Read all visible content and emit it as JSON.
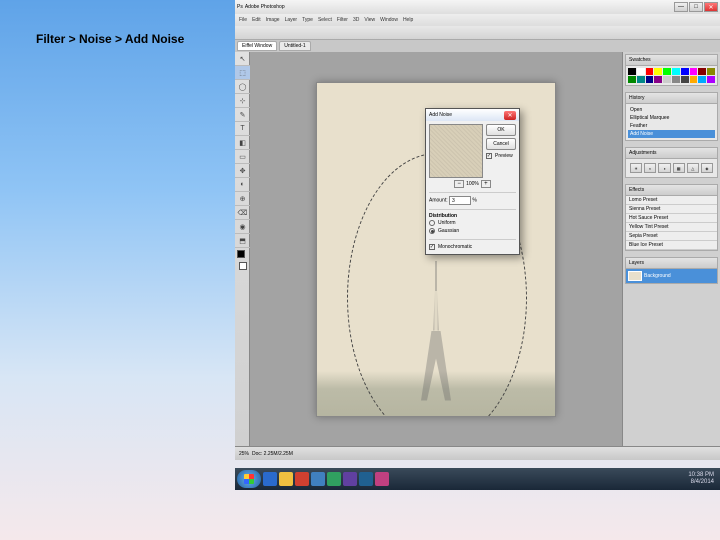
{
  "caption": "Filter > Noise > Add Noise",
  "app": {
    "title": "Adobe Photoshop",
    "menu": [
      "File",
      "Edit",
      "Image",
      "Layer",
      "Type",
      "Select",
      "Filter",
      "3D",
      "View",
      "Window",
      "Help"
    ],
    "win": {
      "min": "—",
      "max": "□",
      "close": "✕"
    }
  },
  "tabs": [
    "Eiffel Window",
    "Untitled-1"
  ],
  "status": {
    "zoom": "25%",
    "doc": "Doc: 2.25M/2.25M"
  },
  "toolbox": [
    "↖",
    "⬚",
    "◯",
    "⊹",
    "✎",
    "T",
    "◧",
    "▭",
    "✥",
    "◐",
    "⊕",
    "⌫",
    "◉",
    "⬒"
  ],
  "panels": {
    "swatches": "Swatches",
    "colors": [
      "#000",
      "#fff",
      "#f00",
      "#ff0",
      "#0f0",
      "#0ff",
      "#00f",
      "#f0f",
      "#800",
      "#880",
      "#080",
      "#088",
      "#008",
      "#808",
      "#ccc",
      "#888",
      "#444",
      "#fa0",
      "#0af",
      "#a0f"
    ],
    "history": {
      "title": "History",
      "items": [
        "Open",
        "Elliptical Marquee",
        "Feather",
        "Add Noise"
      ],
      "selected": 3
    },
    "adjust": {
      "title": "Adjustments",
      "icons": [
        "☀",
        "◐",
        "◑",
        "▦",
        "△",
        "◈"
      ]
    },
    "effects": {
      "title": "Effects",
      "presets": [
        "Lomo Preset",
        "Sienna Preset",
        "Hot Sauce Preset",
        "Yellow Tint Preset",
        "Sepia Preset",
        "Blue Ice Preset"
      ]
    },
    "layers": {
      "title": "Layers",
      "name": "Background"
    }
  },
  "dialog": {
    "title": "Add Noise",
    "ok": "OK",
    "cancel": "Cancel",
    "preview_chk": "Preview",
    "zoom": "100%",
    "amount_label": "Amount:",
    "amount_value": "3",
    "amount_unit": "%",
    "dist_label": "Distribution",
    "uniform": "Uniform",
    "gaussian": "Gaussian",
    "mono": "Monochromatic"
  },
  "taskbar": {
    "time": "10:38 PM",
    "date": "8/4/2014"
  }
}
